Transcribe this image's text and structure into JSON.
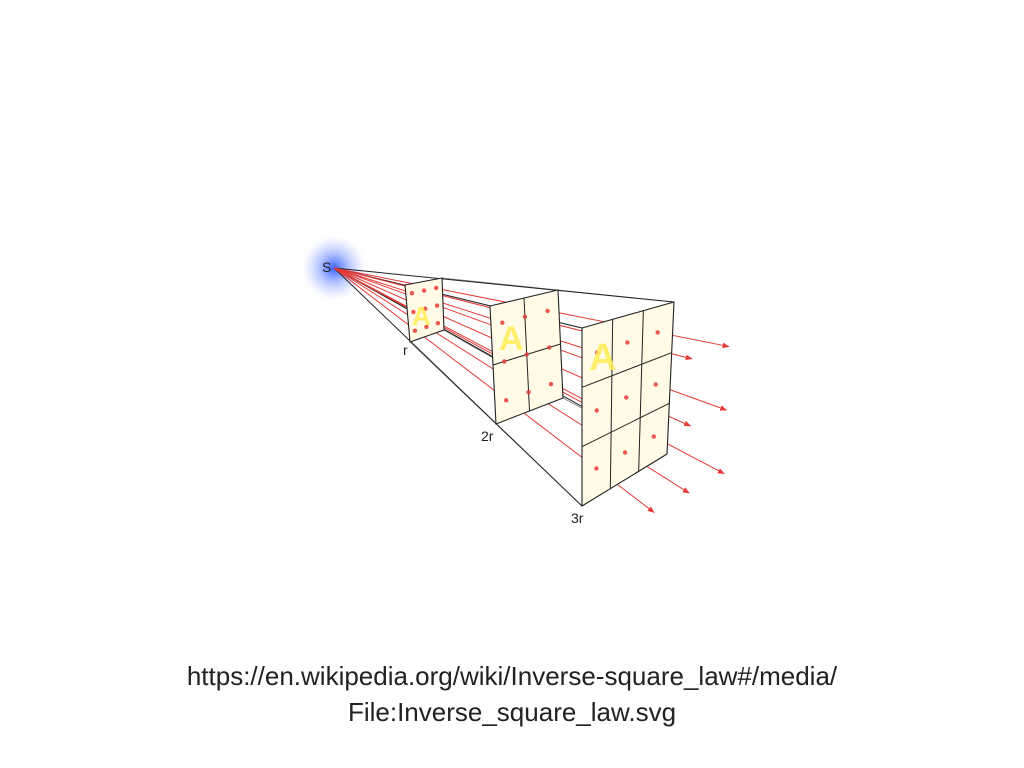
{
  "diagram": {
    "source_label": "S",
    "distance_labels": [
      "r",
      "2r",
      "3r"
    ],
    "area_label": "A",
    "colors": {
      "ray": "#e53935",
      "panel_fill": "#fffbe6",
      "panel_edge": "#222222",
      "source_glow": "#3f6bff",
      "area_letter": "#ffee58"
    }
  },
  "caption": {
    "line1": "https://en.wikipedia.org/wiki/Inverse-square_law#/media/",
    "line2": "File:Inverse_square_law.svg"
  }
}
